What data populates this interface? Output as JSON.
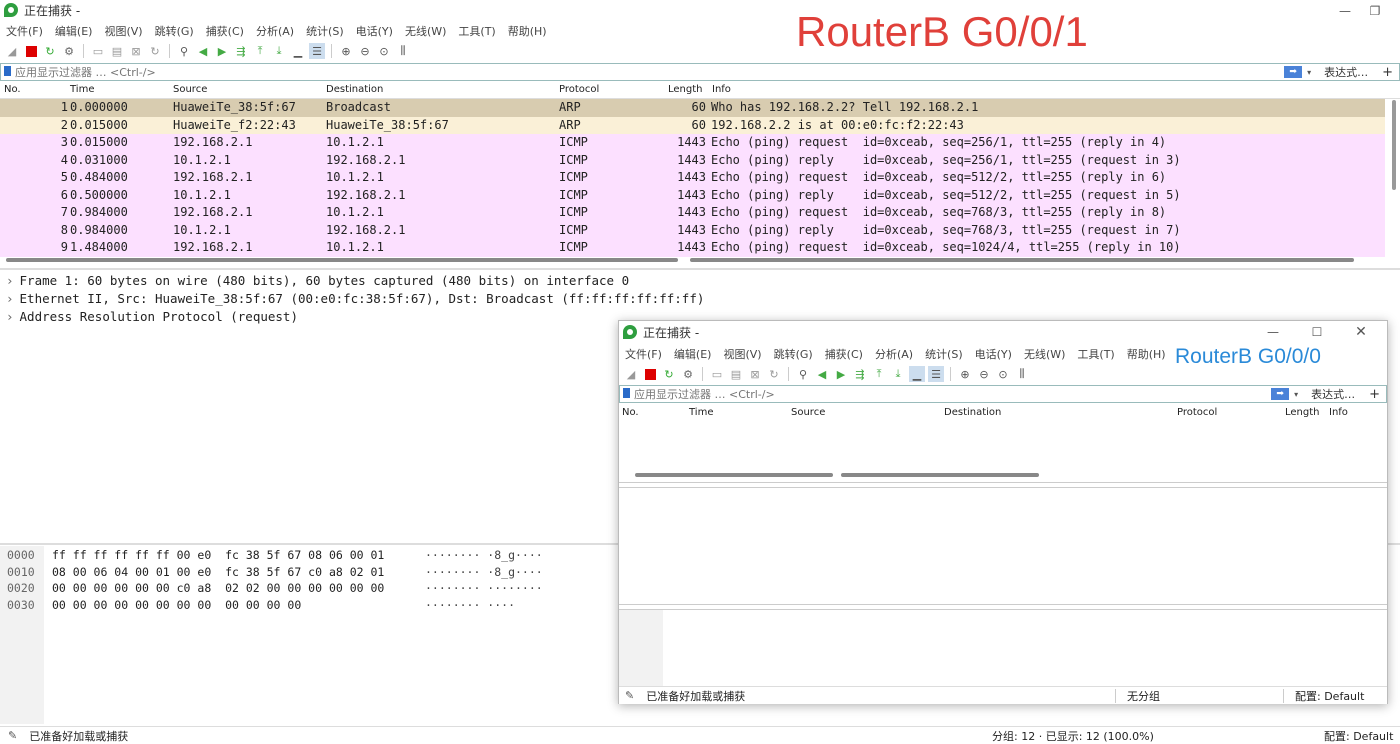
{
  "main": {
    "title": "正在捕获 -",
    "menu": [
      "文件(F)",
      "编辑(E)",
      "视图(V)",
      "跳转(G)",
      "捕获(C)",
      "分析(A)",
      "统计(S)",
      "电话(Y)",
      "无线(W)",
      "工具(T)",
      "帮助(H)"
    ],
    "filter_placeholder": "应用显示过滤器 … <Ctrl-/>",
    "expr_label": "表达式…",
    "plus": "+",
    "columns": [
      "No.",
      "Time",
      "Source",
      "Destination",
      "Protocol",
      "Length",
      "Info"
    ],
    "packets": [
      {
        "no": "1",
        "time": "0.000000",
        "src": "HuaweiTe_38:5f:67",
        "dst": "Broadcast",
        "proto": "ARP",
        "len": "60",
        "info": "Who has 192.168.2.2? Tell 192.168.2.1",
        "kind": "arpsel"
      },
      {
        "no": "2",
        "time": "0.015000",
        "src": "HuaweiTe_f2:22:43",
        "dst": "HuaweiTe_38:5f:67",
        "proto": "ARP",
        "len": "60",
        "info": "192.168.2.2 is at 00:e0:fc:f2:22:43",
        "kind": "arp"
      },
      {
        "no": "3",
        "time": "0.015000",
        "src": "192.168.2.1",
        "dst": "10.1.2.1",
        "proto": "ICMP",
        "len": "1443",
        "info": "Echo (ping) request  id=0xceab, seq=256/1, ttl=255 (reply in 4)",
        "kind": "icmp"
      },
      {
        "no": "4",
        "time": "0.031000",
        "src": "10.1.2.1",
        "dst": "192.168.2.1",
        "proto": "ICMP",
        "len": "1443",
        "info": "Echo (ping) reply    id=0xceab, seq=256/1, ttl=255 (request in 3)",
        "kind": "icmp"
      },
      {
        "no": "5",
        "time": "0.484000",
        "src": "192.168.2.1",
        "dst": "10.1.2.1",
        "proto": "ICMP",
        "len": "1443",
        "info": "Echo (ping) request  id=0xceab, seq=512/2, ttl=255 (reply in 6)",
        "kind": "icmp"
      },
      {
        "no": "6",
        "time": "0.500000",
        "src": "10.1.2.1",
        "dst": "192.168.2.1",
        "proto": "ICMP",
        "len": "1443",
        "info": "Echo (ping) reply    id=0xceab, seq=512/2, ttl=255 (request in 5)",
        "kind": "icmp"
      },
      {
        "no": "7",
        "time": "0.984000",
        "src": "192.168.2.1",
        "dst": "10.1.2.1",
        "proto": "ICMP",
        "len": "1443",
        "info": "Echo (ping) request  id=0xceab, seq=768/3, ttl=255 (reply in 8)",
        "kind": "icmp"
      },
      {
        "no": "8",
        "time": "0.984000",
        "src": "10.1.2.1",
        "dst": "192.168.2.1",
        "proto": "ICMP",
        "len": "1443",
        "info": "Echo (ping) reply    id=0xceab, seq=768/3, ttl=255 (request in 7)",
        "kind": "icmp"
      },
      {
        "no": "9",
        "time": "1.484000",
        "src": "192.168.2.1",
        "dst": "10.1.2.1",
        "proto": "ICMP",
        "len": "1443",
        "info": "Echo (ping) request  id=0xceab, seq=1024/4, ttl=255 (reply in 10)",
        "kind": "icmp"
      }
    ],
    "details": [
      "Frame 1: 60 bytes on wire (480 bits), 60 bytes captured (480 bits) on interface 0",
      "Ethernet II, Src: HuaweiTe_38:5f:67 (00:e0:fc:38:5f:67), Dst: Broadcast (ff:ff:ff:ff:ff:ff)",
      "Address Resolution Protocol (request)"
    ],
    "hex": [
      {
        "off": "0000",
        "bytes": "ff ff ff ff ff ff 00 e0  fc 38 5f 67 08 06 00 01",
        "ascii": "········ ·8_g····"
      },
      {
        "off": "0010",
        "bytes": "08 00 06 04 00 01 00 e0  fc 38 5f 67 c0 a8 02 01",
        "ascii": "········ ·8_g····"
      },
      {
        "off": "0020",
        "bytes": "00 00 00 00 00 00 c0 a8  02 02 00 00 00 00 00 00",
        "ascii": "········ ········"
      },
      {
        "off": "0030",
        "bytes": "00 00 00 00 00 00 00 00  00 00 00 00",
        "ascii": "········ ····"
      }
    ],
    "status_ready": "已准备好加载或捕获",
    "status_packets": "分组: 12 · 已显示: 12 (100.0%)",
    "status_profile": "配置: Default",
    "overlay_label": "RouterB G0/0/1"
  },
  "second": {
    "title": "正在捕获 -",
    "menu": [
      "文件(F)",
      "编辑(E)",
      "视图(V)",
      "跳转(G)",
      "捕获(C)",
      "分析(A)",
      "统计(S)",
      "电话(Y)",
      "无线(W)",
      "工具(T)",
      "帮助(H)"
    ],
    "filter_placeholder": "应用显示过滤器 … <Ctrl-/>",
    "expr_label": "表达式…",
    "plus": "+",
    "columns": [
      "No.",
      "Time",
      "Source",
      "Destination",
      "Protocol",
      "Length",
      "Info"
    ],
    "status_ready": "已准备好加载或捕获",
    "status_group": "无分组",
    "status_profile": "配置: Default",
    "overlay_label": "RouterB G0/0/0"
  },
  "icons": [
    "wireshark-logo-icon",
    "start-capture-icon",
    "stop-capture-icon",
    "restart-capture-icon",
    "capture-options-icon",
    "open-file-icon",
    "save-file-icon",
    "close-file-icon",
    "reload-icon",
    "find-icon",
    "back-icon",
    "forward-icon",
    "goto-icon",
    "first-icon",
    "last-icon",
    "autoscroll-icon",
    "colorize-icon",
    "zoom-in-icon",
    "zoom-out-icon",
    "zoom-reset-icon",
    "resize-columns-icon",
    "bookmark-icon",
    "apply-filter-icon",
    "minimize-icon",
    "maximize-icon",
    "close-icon"
  ],
  "colors": {
    "arp": "#faf0d7",
    "arp_selected": "#d8ccb0",
    "icmp": "#fce0ff",
    "overlay_red": "#e0403a",
    "overlay_blue": "#2a8ad8"
  }
}
